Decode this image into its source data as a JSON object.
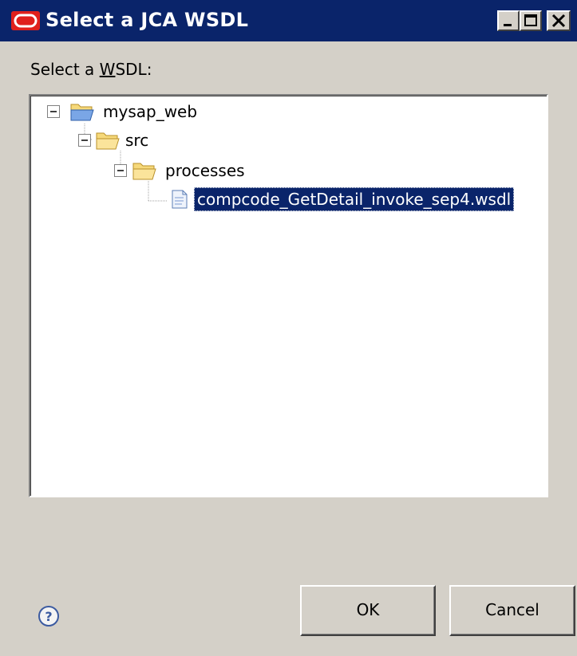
{
  "window": {
    "title": "Select a JCA WSDL",
    "controls": {
      "minimize": "_",
      "maximize": "□",
      "close": "×"
    }
  },
  "label": {
    "prefix": "Select a ",
    "mnemonic": "W",
    "suffix": "SDL:"
  },
  "tree": {
    "nodes": [
      {
        "label": "mysap_web",
        "depth": 0,
        "icon": "open-folder-icon"
      },
      {
        "label": "src",
        "depth": 1,
        "icon": "open-folder-icon"
      },
      {
        "label": "processes",
        "depth": 2,
        "icon": "open-folder-icon"
      },
      {
        "label": "compcode_GetDetail_invoke_sep4.wsdl",
        "depth": 3,
        "icon": "document-icon",
        "selected": true
      }
    ]
  },
  "buttons": {
    "ok": "OK",
    "cancel": "Cancel"
  },
  "help": {
    "glyph": "?"
  },
  "colors": {
    "title_bar": "#0a246a",
    "selection": "#0a246a",
    "background": "#d4d0c8",
    "app_icon": "#e0201c"
  }
}
